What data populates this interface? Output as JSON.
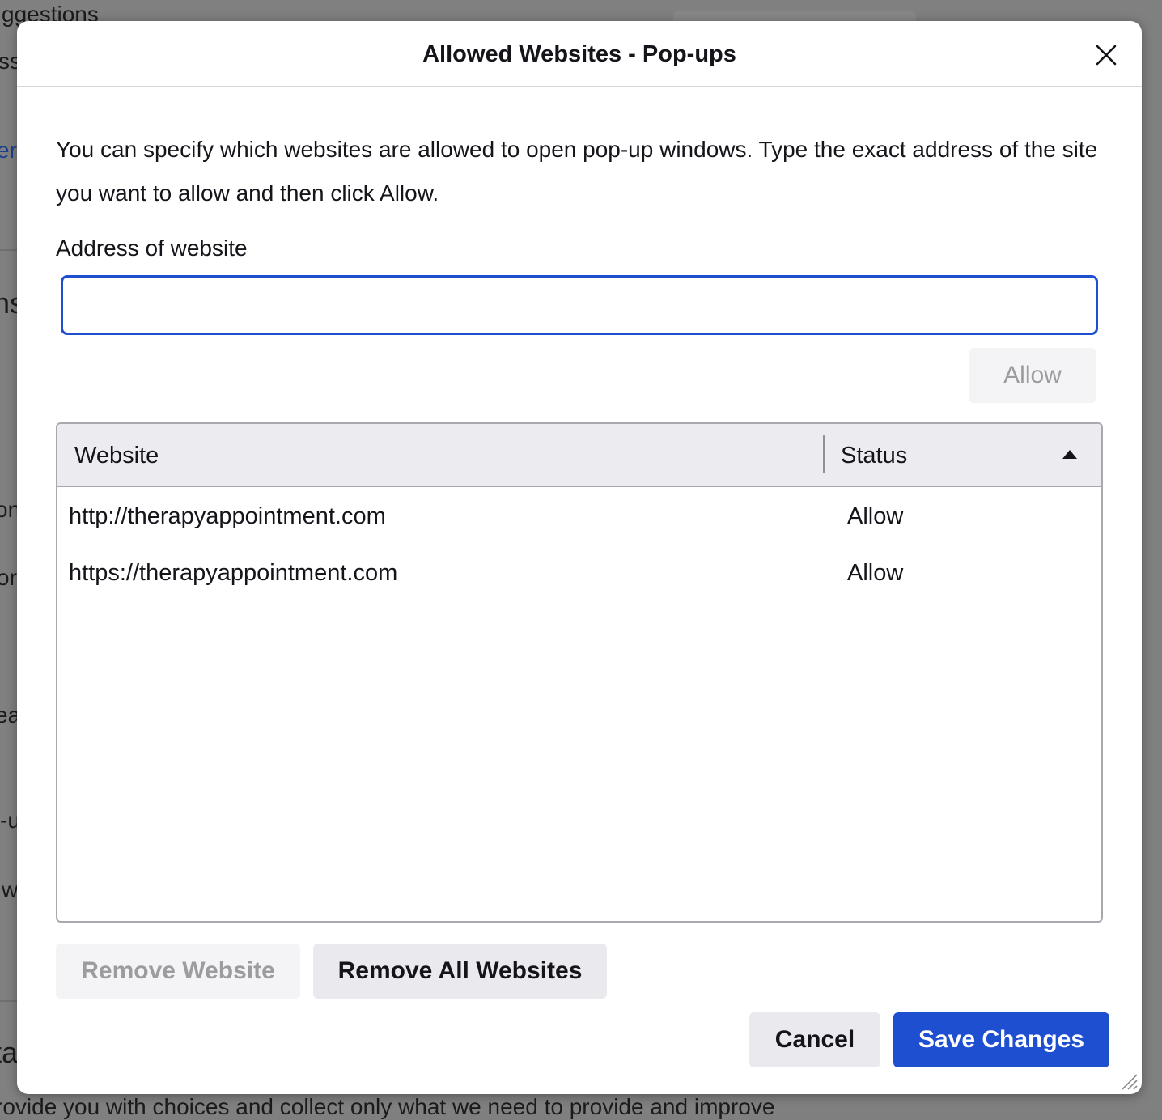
{
  "background": {
    "fragments": [
      "ggestions",
      "ssi",
      "ere",
      "ns",
      "on",
      "or",
      "ea",
      "-u",
      "w",
      "ta",
      "rovide you with choices and collect only what we need to provide and improve"
    ]
  },
  "dialog": {
    "title": "Allowed Websites - Pop-ups",
    "close_icon": "close-icon",
    "description": "You can specify which websites are allowed to open pop-up windows. Type the exact address of the site you want to allow and then click Allow.",
    "address_label": "Address of website",
    "address_value": "",
    "allow_button": "Allow",
    "table": {
      "columns": [
        "Website",
        "Status"
      ],
      "sort_icon": "sort-ascending-icon",
      "rows": [
        {
          "website": "http://therapyappointment.com",
          "status": "Allow"
        },
        {
          "website": "https://therapyappointment.com",
          "status": "Allow"
        }
      ]
    },
    "remove_website_button": "Remove Website",
    "remove_all_button": "Remove All Websites",
    "cancel_button": "Cancel",
    "save_button": "Save Changes",
    "accent_color": "#1f4fd1"
  }
}
